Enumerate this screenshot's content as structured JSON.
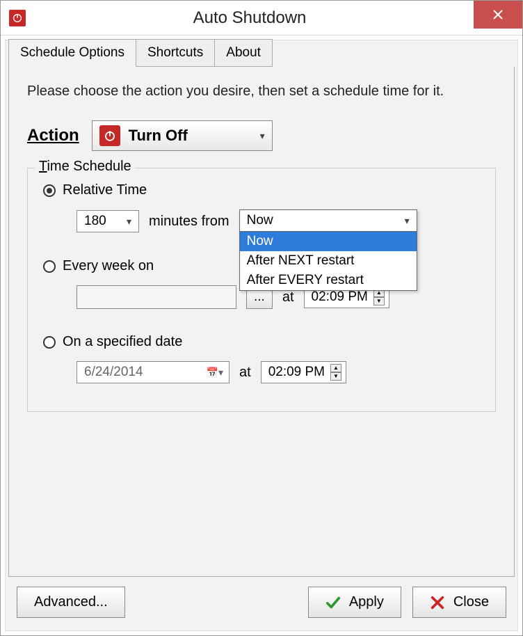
{
  "window": {
    "title": "Auto Shutdown"
  },
  "tabs": [
    "Schedule Options",
    "Shortcuts",
    "About"
  ],
  "instruction": "Please choose the action you desire, then set a schedule time for it.",
  "action": {
    "label": "Action",
    "selected": "Turn Off"
  },
  "fieldset": {
    "legend_underline": "T",
    "legend_rest": "ime Schedule"
  },
  "relative": {
    "label": "Relative Time",
    "minutes": "180",
    "between_text": "minutes from",
    "from_selected": "Now",
    "from_options": [
      "Now",
      "After NEXT restart",
      "After EVERY restart"
    ]
  },
  "weekly": {
    "label": "Every week on",
    "day": "",
    "browse": "...",
    "at_label": "at",
    "time": "02:09 PM"
  },
  "specific": {
    "label": "On a specified date",
    "date": "6/24/2014",
    "at_label": "at",
    "time": "02:09 PM"
  },
  "buttons": {
    "advanced": "Advanced...",
    "apply": "Apply",
    "close": "Close"
  }
}
